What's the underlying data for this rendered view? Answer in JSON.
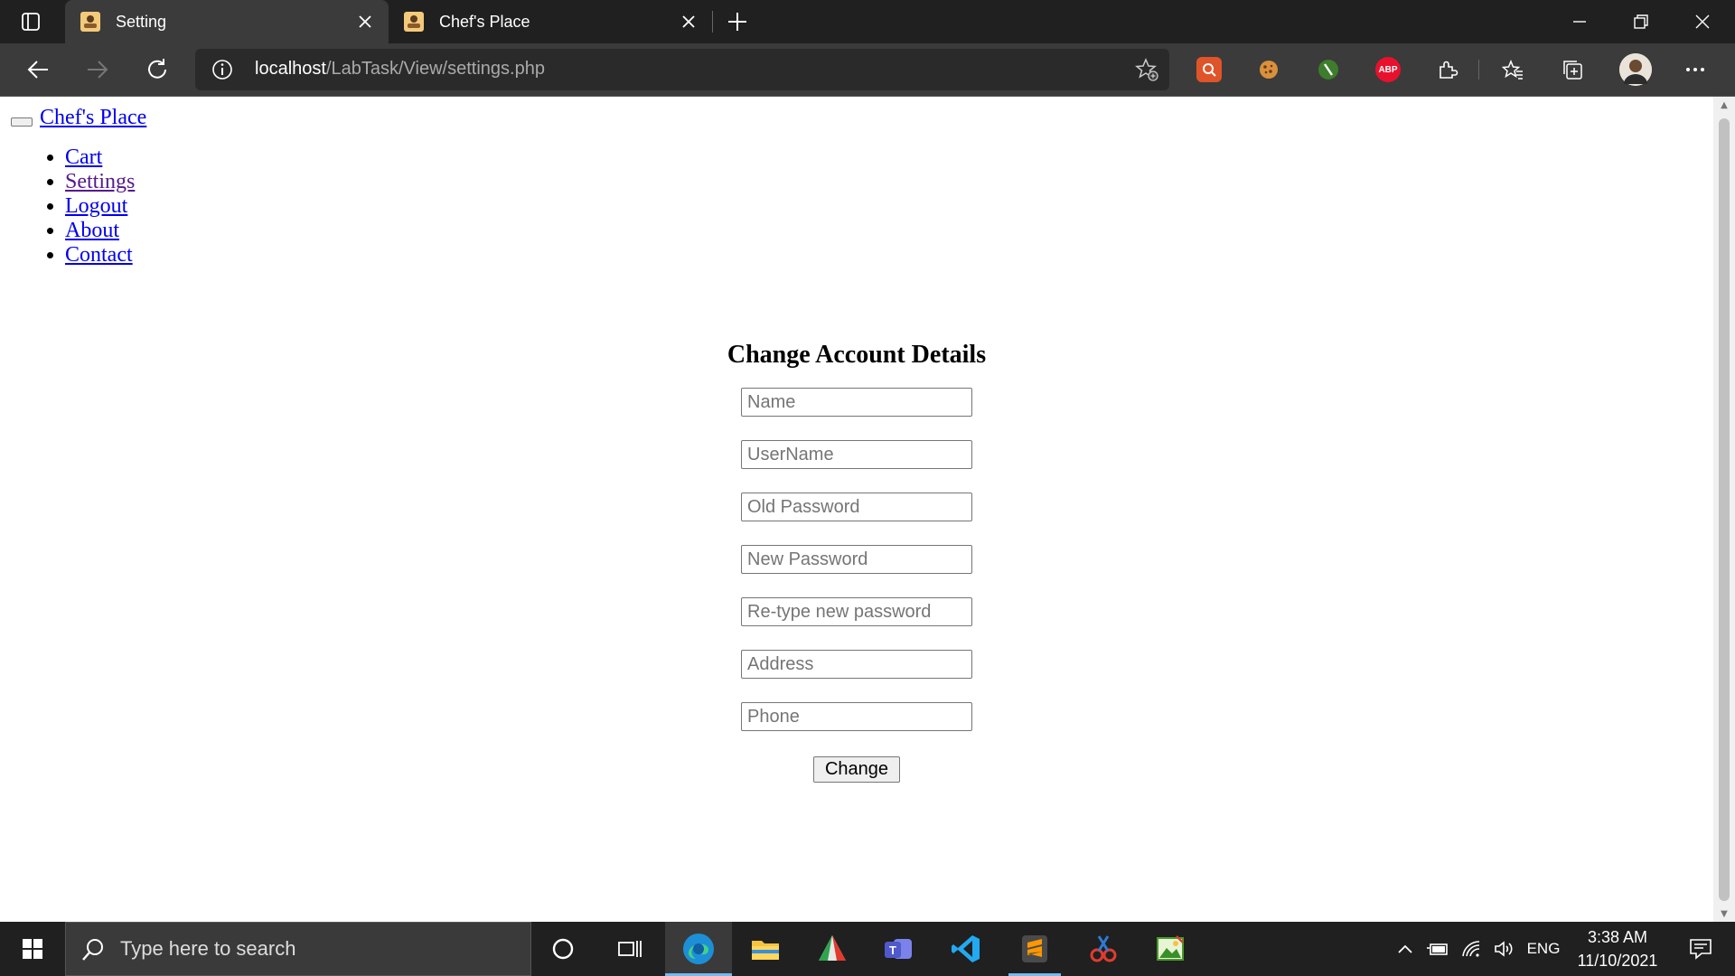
{
  "browser": {
    "tabs": [
      {
        "label": "Setting",
        "active": true
      },
      {
        "label": "Chef's Place",
        "active": false
      }
    ],
    "url_host": "localhost",
    "url_path": "/LabTask/View/settings.php",
    "extensions": [
      "search-extension",
      "cookie-extension",
      "green-extension",
      "adblock-plus-extension"
    ],
    "adblock_label": "ABP"
  },
  "page": {
    "brand": "Chef's Place",
    "nav": [
      "Cart",
      "Settings",
      "Logout",
      "About",
      "Contact"
    ],
    "form": {
      "title": "Change Account Details",
      "fields": [
        {
          "placeholder": "Name",
          "value": ""
        },
        {
          "placeholder": "UserName",
          "value": ""
        },
        {
          "placeholder": "Old Password",
          "value": ""
        },
        {
          "placeholder": "New Password",
          "value": ""
        },
        {
          "placeholder": "Re-type new password",
          "value": ""
        },
        {
          "placeholder": "Address",
          "value": ""
        },
        {
          "placeholder": "Phone",
          "value": ""
        }
      ],
      "submit_label": "Change"
    }
  },
  "taskbar": {
    "search_placeholder": "Type here to search",
    "language": "ENG",
    "time": "3:38 AM",
    "date": "11/10/2021"
  }
}
